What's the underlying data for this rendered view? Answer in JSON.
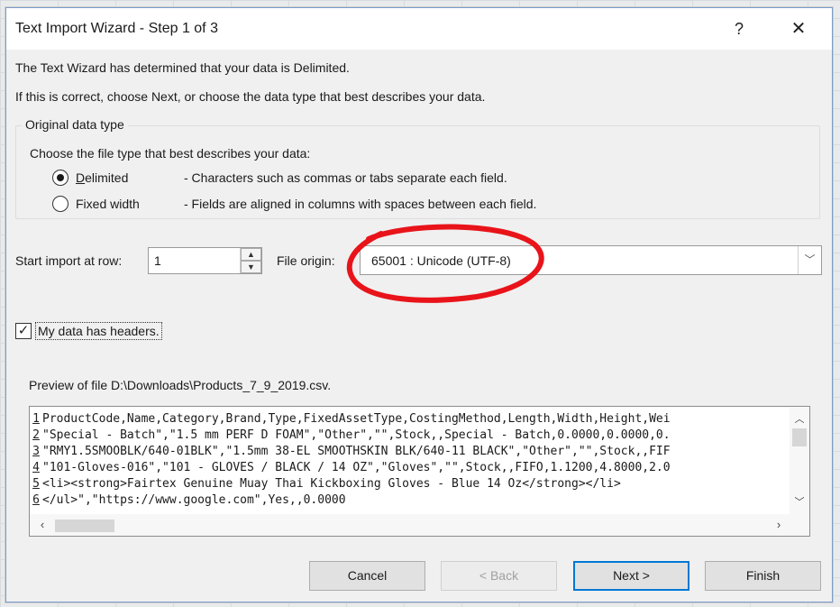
{
  "dialog": {
    "title": "Text Import Wizard - Step 1 of 3",
    "help_label": "?",
    "close_label": "✕"
  },
  "intro": {
    "line1": "The Text Wizard has determined that your data is Delimited.",
    "line2": "If this is correct, choose Next, or choose the data type that best describes your data."
  },
  "original_data_type": {
    "legend": "Original data type",
    "description": "Choose the file type that best describes your data:",
    "options": [
      {
        "label": "Delimited",
        "description": "- Characters such as commas or tabs separate each field.",
        "selected": true
      },
      {
        "label": "Fixed width",
        "description": "- Fields are aligned in columns with spaces between each field.",
        "selected": false
      }
    ]
  },
  "start_import": {
    "label": "Start import at row:",
    "value": "1"
  },
  "file_origin": {
    "label": "File origin:",
    "value": "65001 : Unicode (UTF-8)"
  },
  "annotation": {
    "color": "#e8141a"
  },
  "headers_checkbox": {
    "label": "My data has headers.",
    "checked": true,
    "check_glyph": "✓"
  },
  "preview": {
    "label": "Preview of file D:\\Downloads\\Products_7_9_2019.csv.",
    "lines": [
      {
        "num": "1",
        "text": "ProductCode,Name,Category,Brand,Type,FixedAssetType,CostingMethod,Length,Width,Height,Wei"
      },
      {
        "num": "2",
        "text": "\"Special - Batch\",\"1.5 mm PERF D FOAM\",\"Other\",\"\",Stock,,Special - Batch,0.0000,0.0000,0."
      },
      {
        "num": "3",
        "text": "\"RMY1.5SMOOBLK/640-01BLK\",\"1.5mm 38-EL SMOOTHSKIN BLK/640-11 BLACK\",\"Other\",\"\",Stock,,FIF"
      },
      {
        "num": "4",
        "text": "\"101-Gloves-016\",\"101 - GLOVES / BLACK / 14 OZ\",\"Gloves\",\"\",Stock,,FIFO,1.1200,4.8000,2.0"
      },
      {
        "num": "5",
        "text": "<li><strong>Fairtex Genuine Muay Thai Kickboxing Gloves - Blue 14 Oz</strong></li>"
      },
      {
        "num": "6",
        "text": "</ul>\",\"https://www.google.com\",Yes,,0.0000"
      }
    ]
  },
  "buttons": {
    "cancel": "Cancel",
    "back": "< Back",
    "next": "Next >",
    "finish": "Finish"
  }
}
